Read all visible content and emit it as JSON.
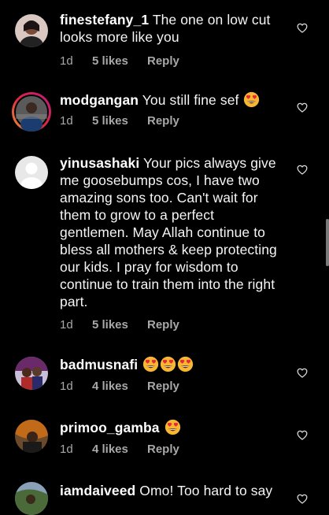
{
  "comments": [
    {
      "username": "finestefany_1",
      "text": "The one on low cut looks more like you",
      "time": "1d",
      "likes": "5 likes",
      "reply": "Reply",
      "emoji_count": 0,
      "avatar_color": "#6b4a3d"
    },
    {
      "username": "modgangan",
      "text": "You still fine sef",
      "time": "1d",
      "likes": "5 likes",
      "reply": "Reply",
      "emoji_count": 1,
      "avatar_color": "#3a3a3a",
      "has_story_ring": true
    },
    {
      "username": "yinusashaki",
      "text": "Your pics always give me goosebumps cos, I have two amazing sons too. Can't wait for them to grow to a perfect gentlemen. May Allah continue to bless all mothers & keep protecting our kids. I pray for wisdom to continue to  train them into the right part.",
      "time": "1d",
      "likes": "5 likes",
      "reply": "Reply",
      "emoji_count": 0,
      "avatar_color": "#e8e8e8"
    },
    {
      "username": "badmusnafi",
      "text": "",
      "time": "1d",
      "likes": "4 likes",
      "reply": "Reply",
      "emoji_count": 3,
      "avatar_color": "#7a3030"
    },
    {
      "username": "primoo_gamba",
      "text": "",
      "time": "1d",
      "likes": "4 likes",
      "reply": "Reply",
      "emoji_count": 1,
      "avatar_color": "#b05a1a"
    },
    {
      "username": "iamdaiveed",
      "text": "Omo! Too hard to say",
      "time": "",
      "likes": "",
      "reply": "",
      "emoji_count": 0,
      "avatar_color": "#4a6a3a"
    }
  ],
  "colors": {
    "background": "#000000",
    "secondary_text": "#a8a8a8",
    "emoji_face": "#f7b731",
    "emoji_heart": "#e8253a"
  },
  "icons": {
    "like": "heart-outline-icon",
    "emoji": "heart-eyes-emoji"
  }
}
